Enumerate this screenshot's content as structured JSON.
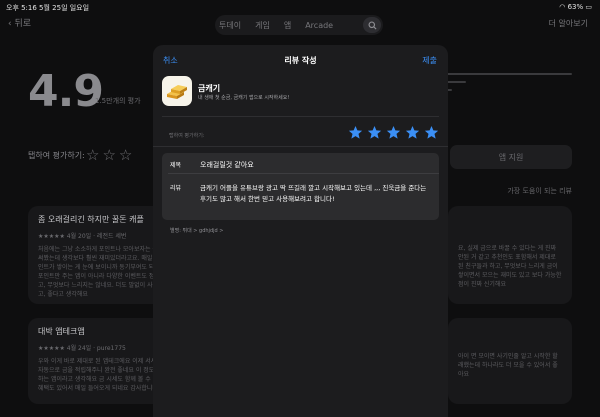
{
  "status_bar": {
    "time_date": "오후 5:16   5월 25일 일요일",
    "battery": "63%"
  },
  "nav": {
    "back_label": "뒤로",
    "more_label": "더 알아보기"
  },
  "segments": [
    "투데이",
    "게임",
    "앱",
    "Arcade"
  ],
  "ratings": {
    "score": "4.9",
    "count_label": "1.5만개의 평가",
    "tap_to_rate": "탭하여 평가하기:",
    "support_label": "앱 지원",
    "sort_label": "가장 도움이 되는 리뷰"
  },
  "background_reviews": [
    {
      "title": "좀 오래걸리긴 하지만 꿀돈 캐플",
      "meta": "★★★★★  4월 20일 · 레전드 세번",
      "body": "처음에는 그냥 소소하게 포인트나 모아보자는 생각으로 앱을 써봤는데 생각보다 훨씬 재미있더라고요. 매일 출석하고 포인트가 쌓이는 게 눈에 보이니까 동기부여도 되고요. 단순히 포인트만 주는 앱이 아니라 다양한 이벤트도 정해서 진짜 가고, 무엇보다 느리지는 않네요. 더도 말없이 사용하기 편하고, 좋다고 생각해요"
    },
    {
      "title": "대박 앱테크앱",
      "meta": "★★★★★  4월 24일 · pure1775",
      "body": "우와 이게 바로 제대로 된 앱테크에요 이제 서서히 적금처럼 자동으로 금을 적립해주니 완전 좋네요 이 정도면 진짜 열일하는 앱이라고 생각해요 금 시세도 함께 볼 수 있고 캐시백 혜택도 있어서 매일 들어오게 되네요 감사합니다"
    },
    {
      "body": "요, 실제 금으로 바꿀 수 있다는 게 진짜 안된 거 같고 추천인도 포함해서 제대로 된 친구들과 하고, 무엇보다 느리게 금이 쌓이면서 모으는 재미도 있고 보다 가능한 점이 진짜 신기해요"
    },
    {
      "body": "아이 면 모이면 사기인줄 알고 시작한 할래했는데 하나라도 더 모을 수 있어서 좋아요"
    }
  ],
  "sheet": {
    "cancel": "취소",
    "title": "리뷰 작성",
    "submit": "제출",
    "app_name": "금캐기",
    "app_subtitle": "내 생애 첫 순금, 금캐기 앱으로 시작하세요!",
    "tap_hint": "탭하여 평가하기:",
    "rating": 5,
    "title_label": "제목",
    "title_value": "오래걸릴것 같아요",
    "review_label": "리뷰",
    "review_value": "금캐기 어플을 유튜브랑 광고 딱 뜨길래 깔고 시작해보고 있는데 ,,, 진욱금을 준다는 후기도 많고 해서 한번 믿고 사용해보려고 합니다!",
    "author": "별명: 튀대 > gdhjdjd >"
  },
  "colors": {
    "accent": "#3b8ff5",
    "sheet_bg": "#1c1c1e",
    "field_bg": "#2c2c2e",
    "gold": "#e0a82e"
  }
}
